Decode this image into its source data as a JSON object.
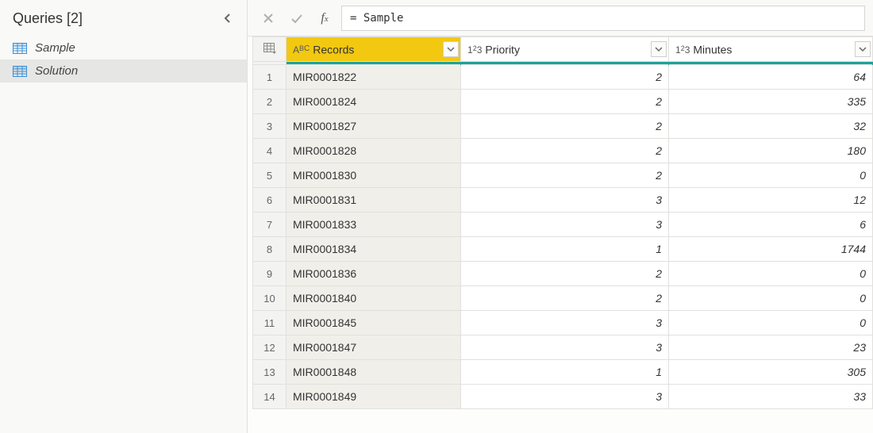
{
  "sidebar": {
    "title": "Queries [2]",
    "items": [
      {
        "label": "Sample",
        "selected": false
      },
      {
        "label": "Solution",
        "selected": true
      }
    ]
  },
  "formula": {
    "value": "= Sample"
  },
  "columns": [
    {
      "key": "Records",
      "label": "Records",
      "type": "text",
      "selected": true
    },
    {
      "key": "Priority",
      "label": "Priority",
      "type": "number",
      "selected": false
    },
    {
      "key": "Minutes",
      "label": "Minutes",
      "type": "number",
      "selected": false
    }
  ],
  "rows": [
    {
      "Records": "MIR0001822",
      "Priority": 2,
      "Minutes": 64
    },
    {
      "Records": "MIR0001824",
      "Priority": 2,
      "Minutes": 335
    },
    {
      "Records": "MIR0001827",
      "Priority": 2,
      "Minutes": 32
    },
    {
      "Records": "MIR0001828",
      "Priority": 2,
      "Minutes": 180
    },
    {
      "Records": "MIR0001830",
      "Priority": 2,
      "Minutes": 0
    },
    {
      "Records": "MIR0001831",
      "Priority": 3,
      "Minutes": 12
    },
    {
      "Records": "MIR0001833",
      "Priority": 3,
      "Minutes": 6
    },
    {
      "Records": "MIR0001834",
      "Priority": 1,
      "Minutes": 1744
    },
    {
      "Records": "MIR0001836",
      "Priority": 2,
      "Minutes": 0
    },
    {
      "Records": "MIR0001840",
      "Priority": 2,
      "Minutes": 0
    },
    {
      "Records": "MIR0001845",
      "Priority": 3,
      "Minutes": 0
    },
    {
      "Records": "MIR0001847",
      "Priority": 3,
      "Minutes": 23
    },
    {
      "Records": "MIR0001848",
      "Priority": 1,
      "Minutes": 305
    },
    {
      "Records": "MIR0001849",
      "Priority": 3,
      "Minutes": 33
    }
  ]
}
